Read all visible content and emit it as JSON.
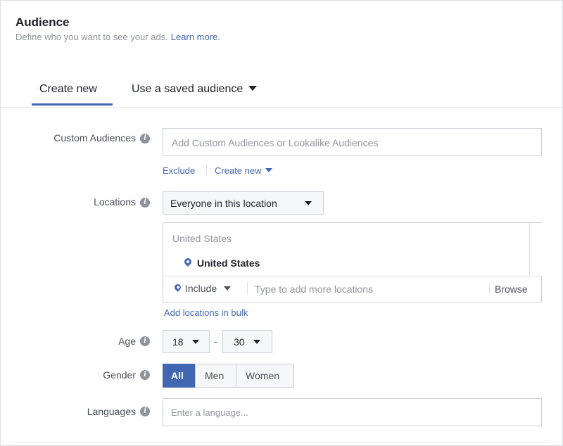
{
  "header": {
    "title": "Audience",
    "subtitle": "Define who you want to see your ads.",
    "learn_more": "Learn more."
  },
  "tabs": [
    {
      "label": "Create new",
      "active": true
    },
    {
      "label": "Use a saved audience",
      "active": false
    }
  ],
  "custom_audiences": {
    "label": "Custom Audiences",
    "placeholder": "Add Custom Audiences or Lookalike Audiences",
    "exclude_label": "Exclude",
    "create_new_label": "Create new"
  },
  "locations": {
    "label": "Locations",
    "dropdown_value": "Everyone in this location",
    "header_text": "United States",
    "selected_item": "United States",
    "include_label": "Include",
    "search_placeholder": "Type to add more locations",
    "browse_label": "Browse",
    "bulk_link": "Add locations in bulk"
  },
  "age": {
    "label": "Age",
    "min": "18",
    "separator": "-",
    "max": "30"
  },
  "gender": {
    "label": "Gender",
    "options": [
      "All",
      "Men",
      "Women"
    ],
    "selected": "All"
  },
  "languages": {
    "label": "Languages",
    "placeholder": "Enter a language..."
  },
  "colors": {
    "accent": "#4267b2",
    "label_text": "#4b4f56",
    "muted_text": "#90949c",
    "border": "#ccd0d5"
  }
}
